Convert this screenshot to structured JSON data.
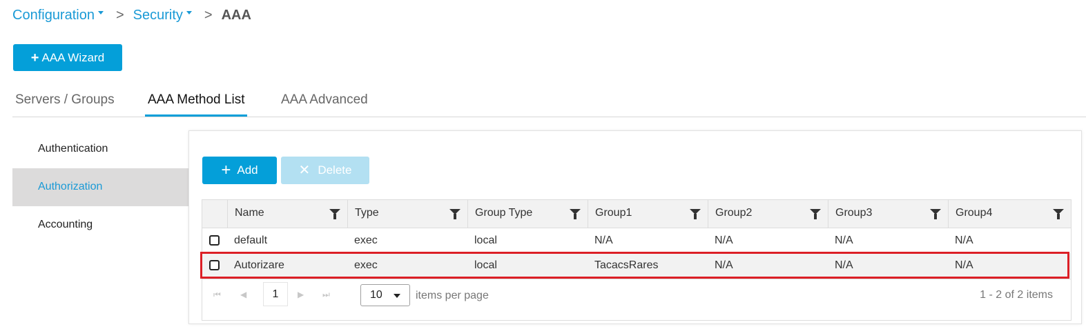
{
  "breadcrumb": {
    "items": [
      {
        "label": "Configuration"
      },
      {
        "label": "Security"
      }
    ],
    "separator": ">",
    "current": "AAA"
  },
  "wizard": {
    "icon": "plus-icon",
    "label": "AAA Wizard"
  },
  "tabs": [
    {
      "label": "Servers / Groups",
      "active": false
    },
    {
      "label": "AAA Method List",
      "active": true
    },
    {
      "label": "AAA Advanced",
      "active": false
    }
  ],
  "sidenav": {
    "items": [
      {
        "label": "Authentication",
        "active": false
      },
      {
        "label": "Authorization",
        "active": true
      },
      {
        "label": "Accounting",
        "active": false
      }
    ]
  },
  "toolbar": {
    "add": {
      "icon": "plus-icon",
      "label": "Add"
    },
    "delete": {
      "icon": "close-icon",
      "label": "Delete",
      "disabled": true
    }
  },
  "table": {
    "columns": [
      "Name",
      "Type",
      "Group Type",
      "Group1",
      "Group2",
      "Group3",
      "Group4"
    ],
    "rows": [
      {
        "checked": false,
        "cells": [
          "default",
          "exec",
          "local",
          "N/A",
          "N/A",
          "N/A",
          "N/A"
        ]
      },
      {
        "checked": false,
        "highlighted": true,
        "cells": [
          "Autorizare",
          "exec",
          "local",
          "TacacsRares",
          "N/A",
          "N/A",
          "N/A"
        ]
      }
    ]
  },
  "pager": {
    "current_page": "1",
    "page_size": "10",
    "page_size_label": "items per page",
    "info": "1 - 2 of 2 items"
  },
  "colors": {
    "accent": "#049fd9",
    "link": "#1a9ad6",
    "highlight": "#dc1f26",
    "active_nav_bg": "#dcdbdb"
  }
}
